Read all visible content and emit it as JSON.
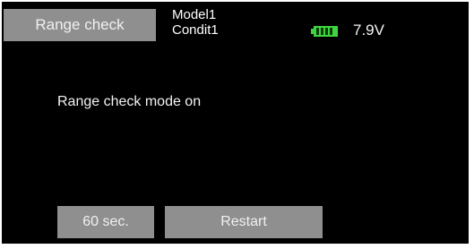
{
  "header": {
    "screen_title": "Range check",
    "model_name": "Model1",
    "condition_name": "Condit1",
    "battery_voltage": "7.9V",
    "battery_icon": "battery-icon",
    "battery_color": "#3fd43f"
  },
  "main": {
    "status_message": "Range check mode on"
  },
  "buttons": {
    "timer_label": "60 sec.",
    "restart_label": "Restart"
  }
}
